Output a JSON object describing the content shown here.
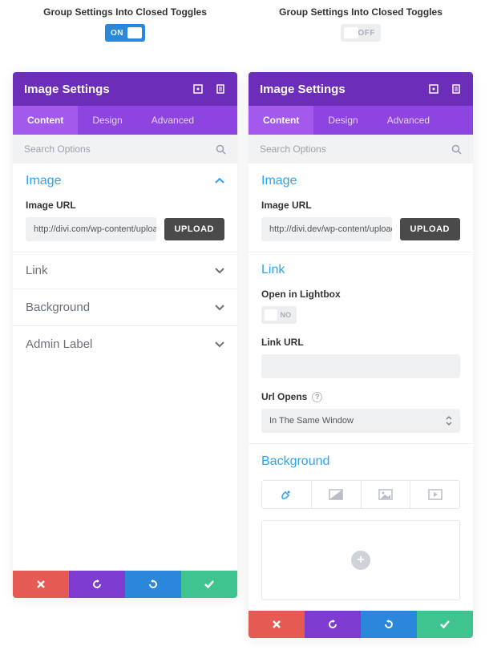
{
  "left": {
    "group_label": "Group Settings Into Closed Toggles",
    "toggle_state": "ON",
    "panel_title": "Image Settings",
    "tabs": {
      "content": "Content",
      "design": "Design",
      "advanced": "Advanced"
    },
    "search_placeholder": "Search Options",
    "image_section_title": "Image",
    "image_url_label": "Image URL",
    "image_url_value": "http://divi.com/wp-content/uploac",
    "upload_label": "UPLOAD",
    "closed": {
      "link": "Link",
      "background": "Background",
      "admin_label": "Admin Label"
    }
  },
  "right": {
    "group_label": "Group Settings Into Closed Toggles",
    "toggle_state": "OFF",
    "panel_title": "Image Settings",
    "tabs": {
      "content": "Content",
      "design": "Design",
      "advanced": "Advanced"
    },
    "search_placeholder": "Search Options",
    "image_section_title": "Image",
    "image_url_label": "Image URL",
    "image_url_value": "http://divi.dev/wp-content/uploac",
    "upload_label": "UPLOAD",
    "link_section_title": "Link",
    "open_lightbox_label": "Open in Lightbox",
    "open_lightbox_value": "NO",
    "link_url_label": "Link URL",
    "link_url_value": "",
    "url_opens_label": "Url Opens",
    "url_opens_value": "In The Same Window",
    "background_section_title": "Background"
  },
  "footer": {
    "close": "close",
    "undo": "undo",
    "redo": "redo",
    "save": "save"
  }
}
